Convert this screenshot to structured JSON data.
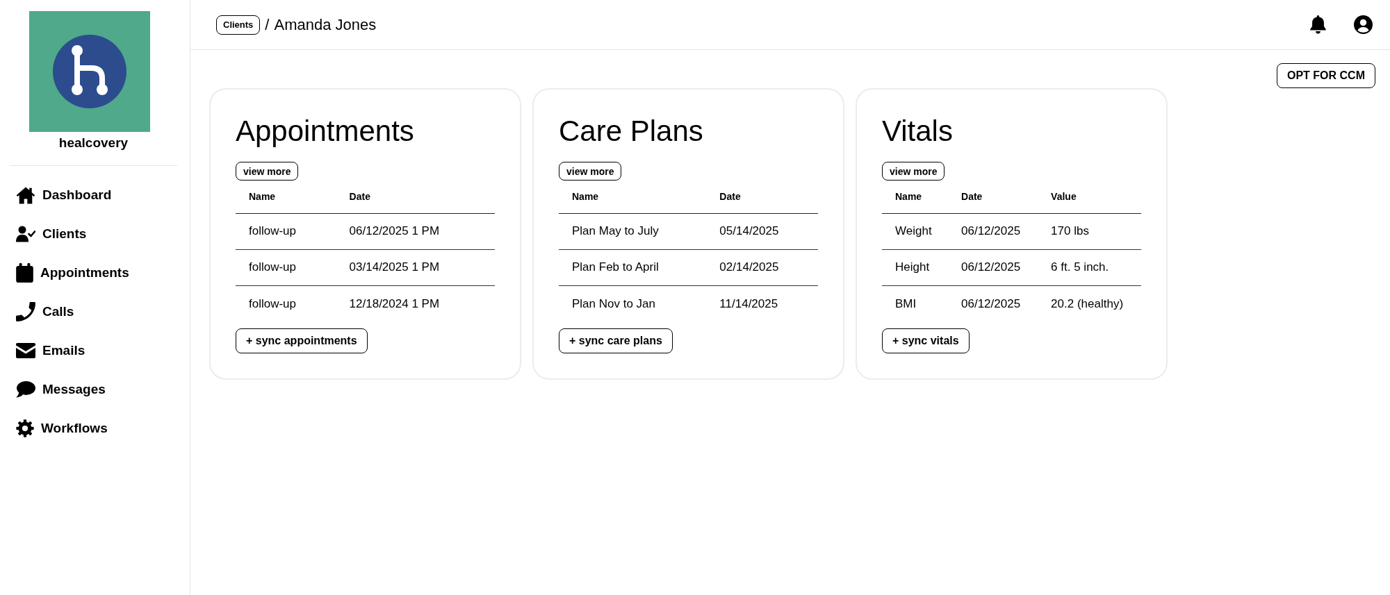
{
  "sidebar": {
    "brand": "healcovery",
    "items": [
      {
        "label": "Dashboard"
      },
      {
        "label": "Clients"
      },
      {
        "label": "Appointments"
      },
      {
        "label": "Calls"
      },
      {
        "label": "Emails"
      },
      {
        "label": "Messages"
      },
      {
        "label": "Workflows"
      }
    ]
  },
  "header": {
    "breadcrumb_link": "Clients",
    "separator": "/",
    "title": "Amanda Jones"
  },
  "actions": {
    "opt_button": "OPT FOR CCM"
  },
  "cards": [
    {
      "title": "Appointments",
      "view_more": "view more",
      "columns": [
        "Name",
        "Date"
      ],
      "rows": [
        [
          "follow-up",
          "06/12/2025 1 PM"
        ],
        [
          "follow-up",
          "03/14/2025 1 PM"
        ],
        [
          "follow-up",
          "12/18/2024 1 PM"
        ]
      ],
      "sync_button": "+ sync appointments"
    },
    {
      "title": "Care Plans",
      "view_more": "view more",
      "columns": [
        "Name",
        "Date"
      ],
      "rows": [
        [
          "Plan May to July",
          "05/14/2025"
        ],
        [
          "Plan Feb to April",
          "02/14/2025"
        ],
        [
          "Plan Nov to Jan",
          "11/14/2025"
        ]
      ],
      "sync_button": "+ sync care plans"
    },
    {
      "title": "Vitals",
      "view_more": "view more",
      "columns": [
        "Name",
        "Date",
        "Value"
      ],
      "rows": [
        [
          "Weight",
          "06/12/2025",
          "170 lbs"
        ],
        [
          "Height",
          "06/12/2025",
          "6 ft. 5 inch."
        ],
        [
          "BMI",
          "06/12/2025",
          "20.2 (healthy)"
        ]
      ],
      "sync_button": "+ sync vitals"
    }
  ]
}
